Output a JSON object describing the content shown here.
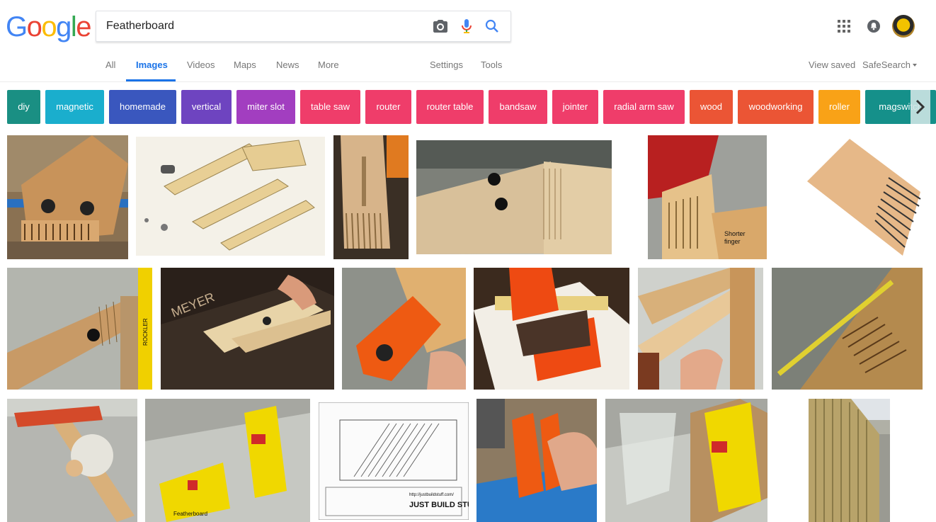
{
  "logo": {
    "letters": [
      "G",
      "o",
      "o",
      "g",
      "l",
      "e"
    ],
    "colors": [
      "#4285F4",
      "#EA4335",
      "#FBBC05",
      "#4285F4",
      "#34A853",
      "#EA4335"
    ]
  },
  "search": {
    "query": "Featherboard"
  },
  "tabs": {
    "all": "All",
    "images": "Images",
    "videos": "Videos",
    "maps": "Maps",
    "news": "News",
    "more": "More",
    "settings": "Settings",
    "tools": "Tools"
  },
  "right_links": {
    "view_saved": "View saved",
    "safesearch": "SafeSearch"
  },
  "chips": [
    {
      "label": "diy",
      "color": "#1a8f83"
    },
    {
      "label": "magnetic",
      "color": "#1aaecd"
    },
    {
      "label": "homemade",
      "color": "#3a57be"
    },
    {
      "label": "vertical",
      "color": "#6e44c0"
    },
    {
      "label": "miter slot",
      "color": "#a23ec0"
    },
    {
      "label": "table saw",
      "color": "#ef3d6a"
    },
    {
      "label": "router",
      "color": "#ef3d6a"
    },
    {
      "label": "router table",
      "color": "#ef3d6a"
    },
    {
      "label": "bandsaw",
      "color": "#ef3d6a"
    },
    {
      "label": "jointer",
      "color": "#ef3d6a"
    },
    {
      "label": "radial arm saw",
      "color": "#ef3d6a"
    },
    {
      "label": "wood",
      "color": "#eb5535"
    },
    {
      "label": "woodworking",
      "color": "#eb5535"
    },
    {
      "label": "roller",
      "color": "#f9a217"
    },
    {
      "label": "magswitch",
      "color": "#15908a"
    }
  ],
  "images": {
    "img3_label1": "Shorter",
    "img3_label2": "finger",
    "img_rockler": "ROCKLER",
    "img_meyer": "MEYER",
    "img_url": "http://justbuildstuff.com/",
    "img_jbs": "JUST BUILD STUFF",
    "img_fb": "Featherboard"
  }
}
